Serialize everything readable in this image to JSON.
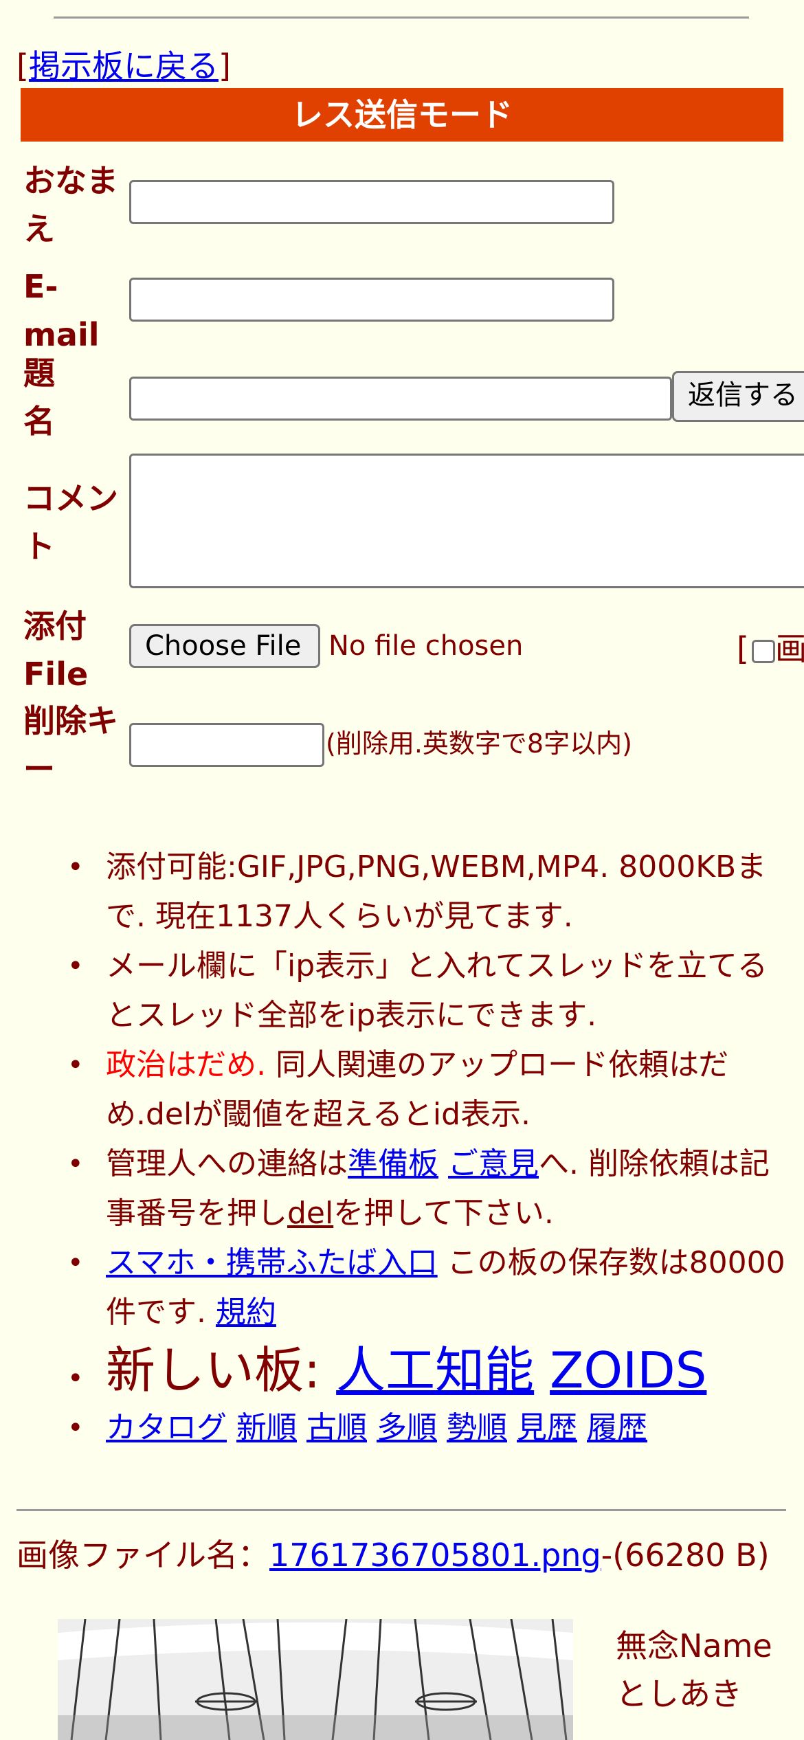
{
  "nav": {
    "bracket_open": "[",
    "back_link": "掲示板に戻る",
    "bracket_close": "]"
  },
  "form": {
    "mode_title": "レス送信モード",
    "name_label": "おなまえ",
    "email_label": "E-mail",
    "subject_label": "題名",
    "submit_label": "返信する",
    "comment_label": "コメント",
    "file_label": "添付File",
    "file_button": "Choose File",
    "file_status": "No file chosen",
    "image_check_open": "[",
    "image_check_label": "画",
    "delkey_label": "削除キー",
    "delkey_hint": "(削除用.英数字で8字以内)"
  },
  "rules": {
    "r1": "添付可能:GIF,JPG,PNG,WEBM,MP4. 8000KBまで. 現在1137人くらいが見てます.",
    "r2": "メール欄に「ip表示」と入れてスレッドを立てるとスレッド全部をip表示にできます.",
    "r3_red": "政治はだめ.",
    "r3_rest": " 同人関連のアップロード依頼はだめ.delが閾値を超えるとid表示.",
    "r4_a": "管理人への連絡は",
    "r4_link1": "準備板",
    "r4_link2": "ご意見",
    "r4_b": "へ. 削除依頼は記事番号を押し",
    "r4_link3": "del",
    "r4_c": "を押して下さい.",
    "r5_link": "スマホ・携帯ふたば入口",
    "r5_text": " この板の保存数は80000件です. ",
    "r5_link2": "規約",
    "r6_text": "新しい板: ",
    "r6_link1": "人工知能",
    "r6_link2": "ZOIDS",
    "nav_links": [
      "カタログ",
      "新順",
      "古順",
      "多順",
      "勢順",
      "見歴",
      "履歴"
    ]
  },
  "post": {
    "file_prefix": "画像ファイル名：",
    "file_link": "1761736705801.png",
    "file_size": "-(66280 B)",
    "name": "無念Name",
    "author": "としあき"
  },
  "colors": {
    "background": "#ffffee",
    "text": "#800000",
    "banner": "#e04000",
    "link": "#0000ee",
    "warning": "#ff0000"
  }
}
